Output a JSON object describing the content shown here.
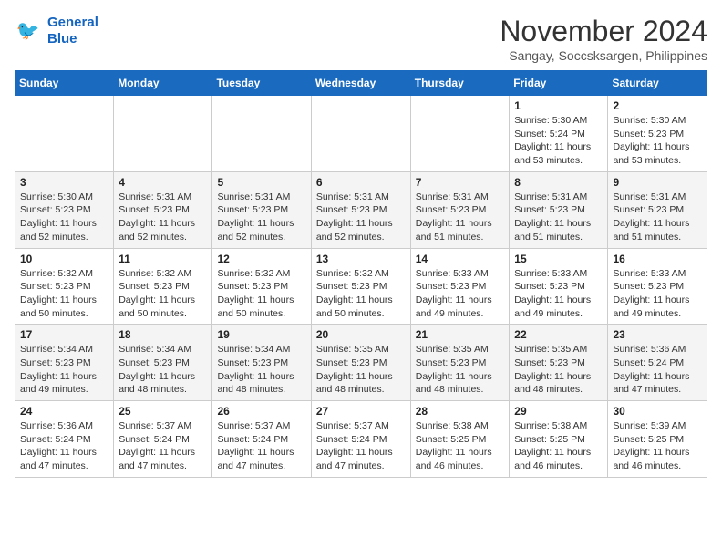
{
  "logo": {
    "line1": "General",
    "line2": "Blue"
  },
  "title": "November 2024",
  "subtitle": "Sangay, Soccsksargen, Philippines",
  "weekdays": [
    "Sunday",
    "Monday",
    "Tuesday",
    "Wednesday",
    "Thursday",
    "Friday",
    "Saturday"
  ],
  "weeks": [
    [
      {
        "day": "",
        "sunrise": "",
        "sunset": "",
        "daylight": ""
      },
      {
        "day": "",
        "sunrise": "",
        "sunset": "",
        "daylight": ""
      },
      {
        "day": "",
        "sunrise": "",
        "sunset": "",
        "daylight": ""
      },
      {
        "day": "",
        "sunrise": "",
        "sunset": "",
        "daylight": ""
      },
      {
        "day": "",
        "sunrise": "",
        "sunset": "",
        "daylight": ""
      },
      {
        "day": "1",
        "sunrise": "Sunrise: 5:30 AM",
        "sunset": "Sunset: 5:24 PM",
        "daylight": "Daylight: 11 hours and 53 minutes."
      },
      {
        "day": "2",
        "sunrise": "Sunrise: 5:30 AM",
        "sunset": "Sunset: 5:23 PM",
        "daylight": "Daylight: 11 hours and 53 minutes."
      }
    ],
    [
      {
        "day": "3",
        "sunrise": "Sunrise: 5:30 AM",
        "sunset": "Sunset: 5:23 PM",
        "daylight": "Daylight: 11 hours and 52 minutes."
      },
      {
        "day": "4",
        "sunrise": "Sunrise: 5:31 AM",
        "sunset": "Sunset: 5:23 PM",
        "daylight": "Daylight: 11 hours and 52 minutes."
      },
      {
        "day": "5",
        "sunrise": "Sunrise: 5:31 AM",
        "sunset": "Sunset: 5:23 PM",
        "daylight": "Daylight: 11 hours and 52 minutes."
      },
      {
        "day": "6",
        "sunrise": "Sunrise: 5:31 AM",
        "sunset": "Sunset: 5:23 PM",
        "daylight": "Daylight: 11 hours and 52 minutes."
      },
      {
        "day": "7",
        "sunrise": "Sunrise: 5:31 AM",
        "sunset": "Sunset: 5:23 PM",
        "daylight": "Daylight: 11 hours and 51 minutes."
      },
      {
        "day": "8",
        "sunrise": "Sunrise: 5:31 AM",
        "sunset": "Sunset: 5:23 PM",
        "daylight": "Daylight: 11 hours and 51 minutes."
      },
      {
        "day": "9",
        "sunrise": "Sunrise: 5:31 AM",
        "sunset": "Sunset: 5:23 PM",
        "daylight": "Daylight: 11 hours and 51 minutes."
      }
    ],
    [
      {
        "day": "10",
        "sunrise": "Sunrise: 5:32 AM",
        "sunset": "Sunset: 5:23 PM",
        "daylight": "Daylight: 11 hours and 50 minutes."
      },
      {
        "day": "11",
        "sunrise": "Sunrise: 5:32 AM",
        "sunset": "Sunset: 5:23 PM",
        "daylight": "Daylight: 11 hours and 50 minutes."
      },
      {
        "day": "12",
        "sunrise": "Sunrise: 5:32 AM",
        "sunset": "Sunset: 5:23 PM",
        "daylight": "Daylight: 11 hours and 50 minutes."
      },
      {
        "day": "13",
        "sunrise": "Sunrise: 5:32 AM",
        "sunset": "Sunset: 5:23 PM",
        "daylight": "Daylight: 11 hours and 50 minutes."
      },
      {
        "day": "14",
        "sunrise": "Sunrise: 5:33 AM",
        "sunset": "Sunset: 5:23 PM",
        "daylight": "Daylight: 11 hours and 49 minutes."
      },
      {
        "day": "15",
        "sunrise": "Sunrise: 5:33 AM",
        "sunset": "Sunset: 5:23 PM",
        "daylight": "Daylight: 11 hours and 49 minutes."
      },
      {
        "day": "16",
        "sunrise": "Sunrise: 5:33 AM",
        "sunset": "Sunset: 5:23 PM",
        "daylight": "Daylight: 11 hours and 49 minutes."
      }
    ],
    [
      {
        "day": "17",
        "sunrise": "Sunrise: 5:34 AM",
        "sunset": "Sunset: 5:23 PM",
        "daylight": "Daylight: 11 hours and 49 minutes."
      },
      {
        "day": "18",
        "sunrise": "Sunrise: 5:34 AM",
        "sunset": "Sunset: 5:23 PM",
        "daylight": "Daylight: 11 hours and 48 minutes."
      },
      {
        "day": "19",
        "sunrise": "Sunrise: 5:34 AM",
        "sunset": "Sunset: 5:23 PM",
        "daylight": "Daylight: 11 hours and 48 minutes."
      },
      {
        "day": "20",
        "sunrise": "Sunrise: 5:35 AM",
        "sunset": "Sunset: 5:23 PM",
        "daylight": "Daylight: 11 hours and 48 minutes."
      },
      {
        "day": "21",
        "sunrise": "Sunrise: 5:35 AM",
        "sunset": "Sunset: 5:23 PM",
        "daylight": "Daylight: 11 hours and 48 minutes."
      },
      {
        "day": "22",
        "sunrise": "Sunrise: 5:35 AM",
        "sunset": "Sunset: 5:23 PM",
        "daylight": "Daylight: 11 hours and 48 minutes."
      },
      {
        "day": "23",
        "sunrise": "Sunrise: 5:36 AM",
        "sunset": "Sunset: 5:24 PM",
        "daylight": "Daylight: 11 hours and 47 minutes."
      }
    ],
    [
      {
        "day": "24",
        "sunrise": "Sunrise: 5:36 AM",
        "sunset": "Sunset: 5:24 PM",
        "daylight": "Daylight: 11 hours and 47 minutes."
      },
      {
        "day": "25",
        "sunrise": "Sunrise: 5:37 AM",
        "sunset": "Sunset: 5:24 PM",
        "daylight": "Daylight: 11 hours and 47 minutes."
      },
      {
        "day": "26",
        "sunrise": "Sunrise: 5:37 AM",
        "sunset": "Sunset: 5:24 PM",
        "daylight": "Daylight: 11 hours and 47 minutes."
      },
      {
        "day": "27",
        "sunrise": "Sunrise: 5:37 AM",
        "sunset": "Sunset: 5:24 PM",
        "daylight": "Daylight: 11 hours and 47 minutes."
      },
      {
        "day": "28",
        "sunrise": "Sunrise: 5:38 AM",
        "sunset": "Sunset: 5:25 PM",
        "daylight": "Daylight: 11 hours and 46 minutes."
      },
      {
        "day": "29",
        "sunrise": "Sunrise: 5:38 AM",
        "sunset": "Sunset: 5:25 PM",
        "daylight": "Daylight: 11 hours and 46 minutes."
      },
      {
        "day": "30",
        "sunrise": "Sunrise: 5:39 AM",
        "sunset": "Sunset: 5:25 PM",
        "daylight": "Daylight: 11 hours and 46 minutes."
      }
    ]
  ]
}
